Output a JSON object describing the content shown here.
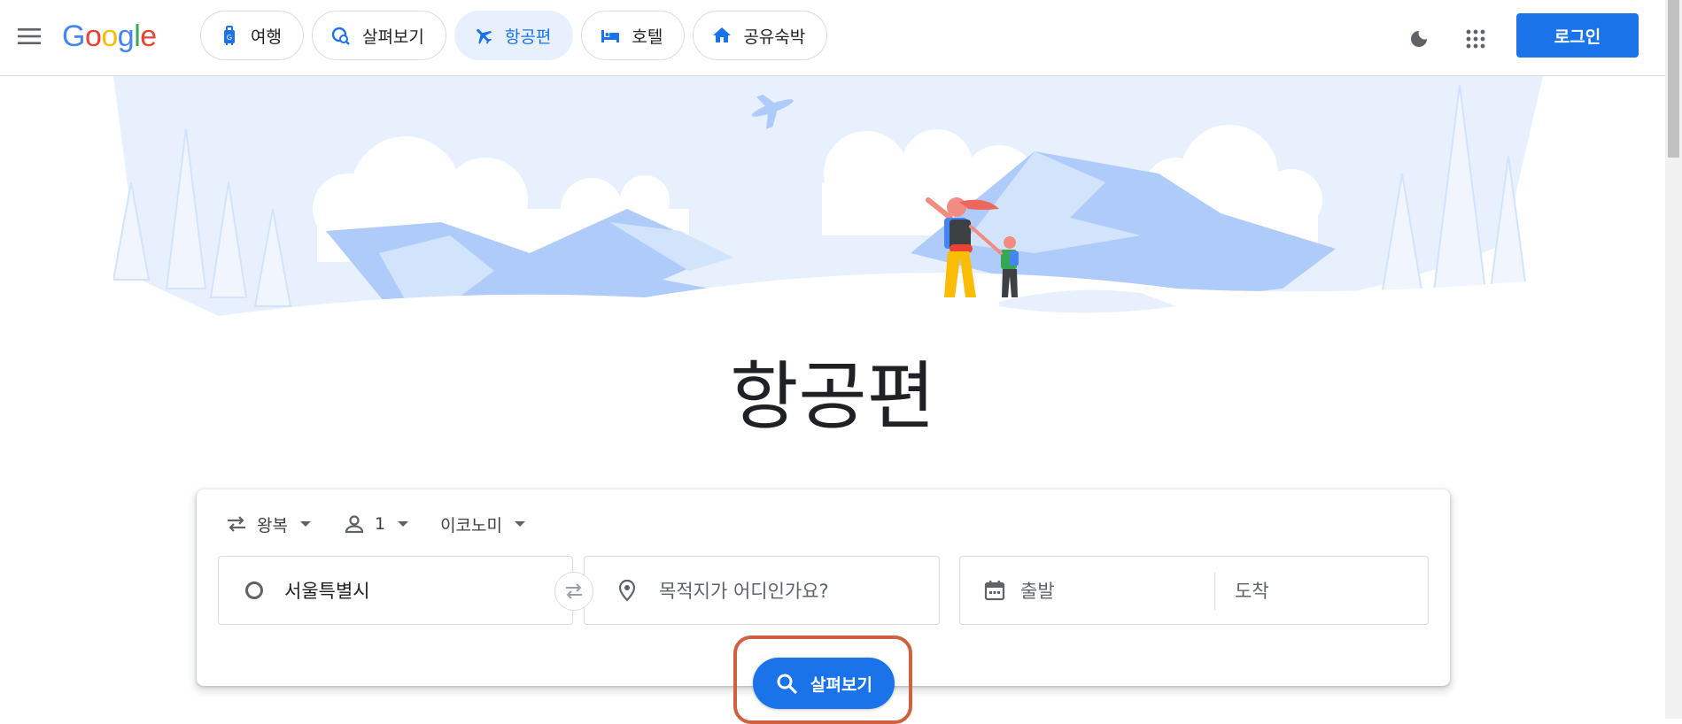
{
  "header": {
    "logo": "Google",
    "tabs": [
      {
        "label": "여행",
        "icon": "luggage-icon"
      },
      {
        "label": "살펴보기",
        "icon": "explore-icon"
      },
      {
        "label": "항공편",
        "icon": "flight-icon",
        "active": true
      },
      {
        "label": "호텔",
        "icon": "hotel-icon"
      },
      {
        "label": "공유숙박",
        "icon": "home-icon"
      }
    ],
    "login_label": "로그인",
    "colors": {
      "accent": "#1a73e8",
      "active_tab_bg": "#e8f0fe"
    }
  },
  "page_title": "항공편",
  "search": {
    "trip_type": "왕복",
    "passengers": "1",
    "cabin_class": "이코노미",
    "origin_value": "서울특별시",
    "destination_placeholder": "목적지가 어디인가요?",
    "depart_placeholder": "출발",
    "return_placeholder": "도착",
    "explore_label": "살펴보기"
  }
}
